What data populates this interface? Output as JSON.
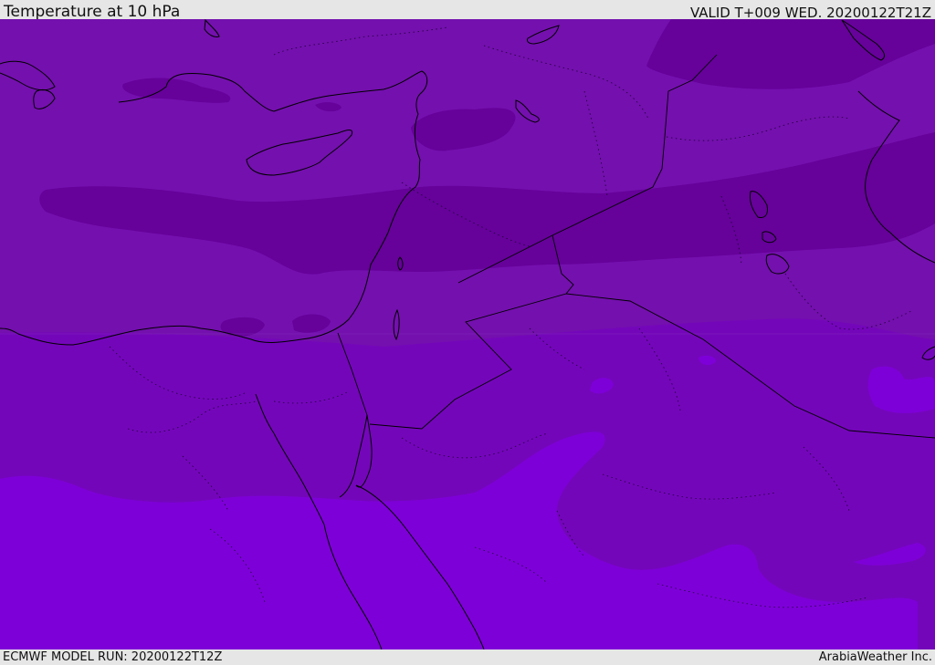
{
  "header": {
    "title": "Temperature at 10 hPa",
    "valid": "VALID T+009 WED. 20200122T21Z"
  },
  "footer": {
    "model_run": "ECMWF MODEL RUN: 20200122T12Z",
    "credit": "ArabiaWeather Inc."
  },
  "colors": {
    "band_cold": "#66019a",
    "band_mid": "#7410ae",
    "band_warm": "#7406ba",
    "band_warmest": "#7e00d8",
    "coastline": "#000000",
    "bar_background": "#e6e6e6"
  }
}
